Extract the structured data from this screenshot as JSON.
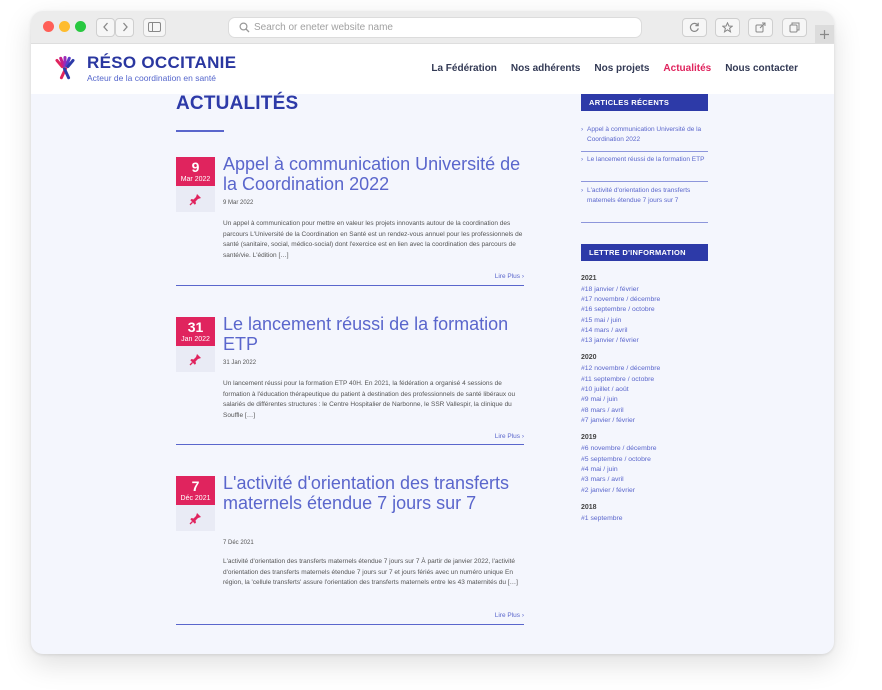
{
  "browser": {
    "url_placeholder": "Search or eneter website name",
    "back_icon": "chevron-left-icon",
    "forward_icon": "chevron-right-icon",
    "sidebar_icon": "sidebar-icon",
    "search_icon": "search-icon",
    "reload_icon": "reload-icon",
    "star_icon": "star-icon",
    "share_icon": "share-icon",
    "tabs_icon": "tabs-icon",
    "new_tab_icon": "plus-icon"
  },
  "site": {
    "brand": "RÉSO OCCITANIE",
    "tagline": "Acteur de la coordination en santé",
    "nav": [
      {
        "label": "La Fédération",
        "active": false
      },
      {
        "label": "Nos adhérents",
        "active": false
      },
      {
        "label": "Nos projets",
        "active": false
      },
      {
        "label": "Actualités",
        "active": true
      },
      {
        "label": "Nous contacter",
        "active": false
      }
    ]
  },
  "page": {
    "title": "ACTUALITÉS"
  },
  "articles": [
    {
      "day": "9",
      "month": "Mar 2022",
      "title": "Appel à communication Université de la Coordination 2022",
      "date": "9 Mar 2022",
      "excerpt": "Un appel à communication pour mettre en valeur les projets innovants autour de la coordination des parcours L'Université de la Coordination en Santé est un rendez-vous annuel pour les professionnels de santé (sanitaire, social, médico-social) dont l'exercice est en lien avec la coordination des parcours de santé/vie. L'édition […]",
      "more": "Lire Plus ›"
    },
    {
      "day": "31",
      "month": "Jan 2022",
      "title": "Le lancement réussi de la formation ETP",
      "date": "31 Jan 2022",
      "excerpt": "Un lancement réussi pour la formation ETP 40H. En 2021, la fédération a organisé 4 sessions de formation à l'éducation thérapeutique du patient à destination des professionnels de santé libéraux ou salariés de différentes structures : le Centre Hospitalier de Narbonne, le SSR Vallespir, la clinique du Souffle […]",
      "more": "Lire Plus ›"
    },
    {
      "day": "7",
      "month": "Déc 2021",
      "title": "L'activité d'orientation des transferts maternels étendue 7 jours sur 7",
      "date": "7 Déc 2021",
      "excerpt": "L'activité d'orientation des transferts maternels étendue 7 jours sur 7  À partir de janvier 2022, l'activité d'orientation des transferts maternels étendue 7 jours sur 7 et jours fériés avec un numéro unique En région, la 'cellule transferts' assure l'orientation des transferts maternels entre les 43 maternités du […]",
      "more": "Lire Plus ›"
    }
  ],
  "sidebar": {
    "recent_title": "ARTICLES RÉCENTS",
    "recent": [
      "Appel à communication Université de la Coordination 2022",
      "Le lancement réussi de la formation ETP",
      "L'activité d'orientation des transferts maternels étendue 7 jours sur 7"
    ],
    "newsletter_title": "LETTRE D'INFORMATION",
    "years": [
      {
        "year": "2021",
        "issues": [
          "#18 janvier / février",
          "#17 novembre / décembre",
          "#16 septembre / octobre",
          "#15 mai / juin",
          "#14 mars / avril",
          "#13 janvier / février"
        ]
      },
      {
        "year": "2020",
        "issues": [
          "#12 novembre / décembre",
          "#11 septembre / octobre",
          "#10 juillet / août",
          "#9 mai / juin",
          "#8 mars / avril",
          "#7 janvier / février"
        ]
      },
      {
        "year": "2019",
        "issues": [
          "#6 novembre / décembre",
          "#5 septembre / octobre",
          "#4 mai / juin",
          "#3 mars / avril",
          "#2 janvier / février"
        ]
      },
      {
        "year": "2018",
        "issues": [
          "#1 septembre"
        ]
      }
    ]
  },
  "colors": {
    "primary": "#2d3aa8",
    "link": "#5a66cc",
    "accent": "#e0245e",
    "background": "#f4f6fd"
  }
}
